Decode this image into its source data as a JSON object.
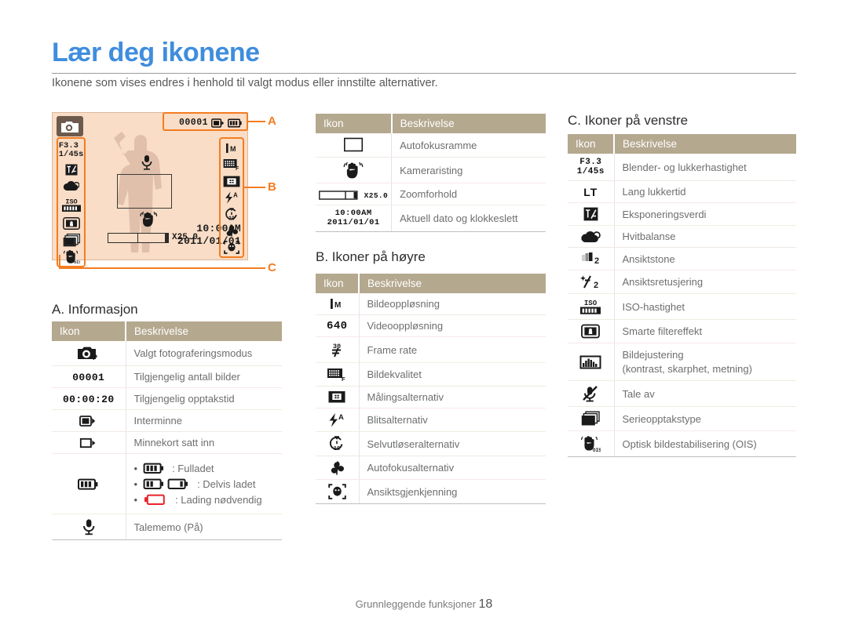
{
  "header": {
    "title": "Lær deg ikonene",
    "intro": "Ikonene som vises endres i henhold til valgt modus eller innstilte alternativer."
  },
  "lcd": {
    "mode_icon": "camera-program-mode-icon",
    "shots_remaining": "00001",
    "internal_memory_icon": "internal-memory-icon",
    "battery_icon": "battery-full-icon",
    "aperture": "F3.3",
    "shutter": "1/45s",
    "zoom_ratio": "X25.0",
    "time": "10:00AM",
    "date": "2011/01/01",
    "left_icons": [
      "aperture-shutter-value",
      "exposure-value-icon",
      "white-balance-icon",
      "iso-speed-icon",
      "smart-filter-icon",
      "burst-type-icon",
      "ois-icon"
    ],
    "right_icons": [
      "photo-resolution-icon",
      "photo-quality-icon",
      "metering-icon",
      "flash-auto-icon",
      "self-timer-10s-icon",
      "macro-af-icon",
      "face-detection-icon"
    ],
    "callouts": {
      "a": "A",
      "b": "B",
      "c": "C"
    }
  },
  "tables": {
    "columns": {
      "icon": "Ikon",
      "description": "Beskrivelse"
    },
    "common": {
      "rows": [
        {
          "icon": "af-frame-icon",
          "desc": "Autofokusramme"
        },
        {
          "icon": "camera-shake-icon",
          "desc": "Kameraristing"
        },
        {
          "icon": "zoom-bar-icon",
          "value": "X25.0",
          "desc": "Zoomforhold"
        },
        {
          "icon": "date-time-icon",
          "value_1": "10:00AM",
          "value_2": "2011/01/01",
          "desc": "Aktuell dato og klokkeslett"
        }
      ]
    },
    "a": {
      "heading": "A. Informasjon",
      "rows": [
        {
          "icon": "camera-program-mode-icon",
          "desc": "Valgt fotograferingsmodus"
        },
        {
          "icon": "shots-remaining-value",
          "value": "00001",
          "desc": "Tilgjengelig antall bilder"
        },
        {
          "icon": "recording-time-value",
          "value": "00:00:20",
          "desc": "Tilgjengelig opptakstid"
        },
        {
          "icon": "internal-memory-icon",
          "desc": "Interminne"
        },
        {
          "icon": "memory-card-icon",
          "desc": "Minnekort satt inn"
        },
        {
          "icon": "battery-icon",
          "desc": "",
          "bullets": [
            {
              "icon": "battery-full-icon",
              "text": ": Fulladet"
            },
            {
              "icon": "battery-partial-icon",
              "text": ": Delvis ladet"
            },
            {
              "icon": "battery-empty-icon",
              "text": ": Lading nødvendig"
            }
          ]
        },
        {
          "icon": "voice-memo-icon",
          "desc": "Talememo (På)"
        }
      ]
    },
    "b": {
      "heading": "B. Ikoner på høyre",
      "rows": [
        {
          "icon": "photo-resolution-icon",
          "desc": "Bildeoppløsning"
        },
        {
          "icon": "video-resolution-icon",
          "value": "640",
          "desc": "Videooppløsning"
        },
        {
          "icon": "frame-rate-icon",
          "value": "30",
          "desc": "Frame rate"
        },
        {
          "icon": "photo-quality-icon",
          "desc": "Bildekvalitet"
        },
        {
          "icon": "metering-icon",
          "desc": "Målingsalternativ"
        },
        {
          "icon": "flash-auto-icon",
          "desc": "Blitsalternativ"
        },
        {
          "icon": "self-timer-icon",
          "desc": "Selvutløseralternativ"
        },
        {
          "icon": "macro-af-icon",
          "desc": "Autofokusalternativ"
        },
        {
          "icon": "face-detection-icon",
          "desc": "Ansiktsgjenkjenning"
        }
      ]
    },
    "c": {
      "heading": "C. Ikoner på venstre",
      "rows": [
        {
          "icon": "aperture-shutter-icon",
          "value_1": "F3.3",
          "value_2": "1/45s",
          "desc": "Blender- og lukkerhastighet"
        },
        {
          "icon": "long-time-shutter-icon",
          "value": "LT",
          "desc": "Lang lukkertid"
        },
        {
          "icon": "exposure-value-icon",
          "desc": "Eksponeringsverdi"
        },
        {
          "icon": "white-balance-icon",
          "desc": "Hvitbalanse"
        },
        {
          "icon": "face-tone-icon",
          "desc": "Ansiktstone"
        },
        {
          "icon": "face-retouch-icon",
          "desc": "Ansiktsretusjering"
        },
        {
          "icon": "iso-speed-icon",
          "desc": "ISO-hastighet"
        },
        {
          "icon": "smart-filter-icon",
          "desc": "Smarte filtereffekt"
        },
        {
          "icon": "image-adjust-icon",
          "desc": "Bildejustering",
          "desc2": "(kontrast, skarphet, metning)"
        },
        {
          "icon": "voice-off-icon",
          "desc": "Tale av"
        },
        {
          "icon": "burst-type-icon",
          "desc": "Serieopptakstype"
        },
        {
          "icon": "ois-icon",
          "desc": "Optisk bildestabilisering (OIS)"
        }
      ]
    }
  },
  "footer": {
    "label": "Grunnleggende funksjoner",
    "page": "18"
  },
  "colors": {
    "title": "#3f8ddd",
    "accent": "#f47c20",
    "table_header": "#b4a88f",
    "lcd_bg": "#f9ddc6"
  }
}
